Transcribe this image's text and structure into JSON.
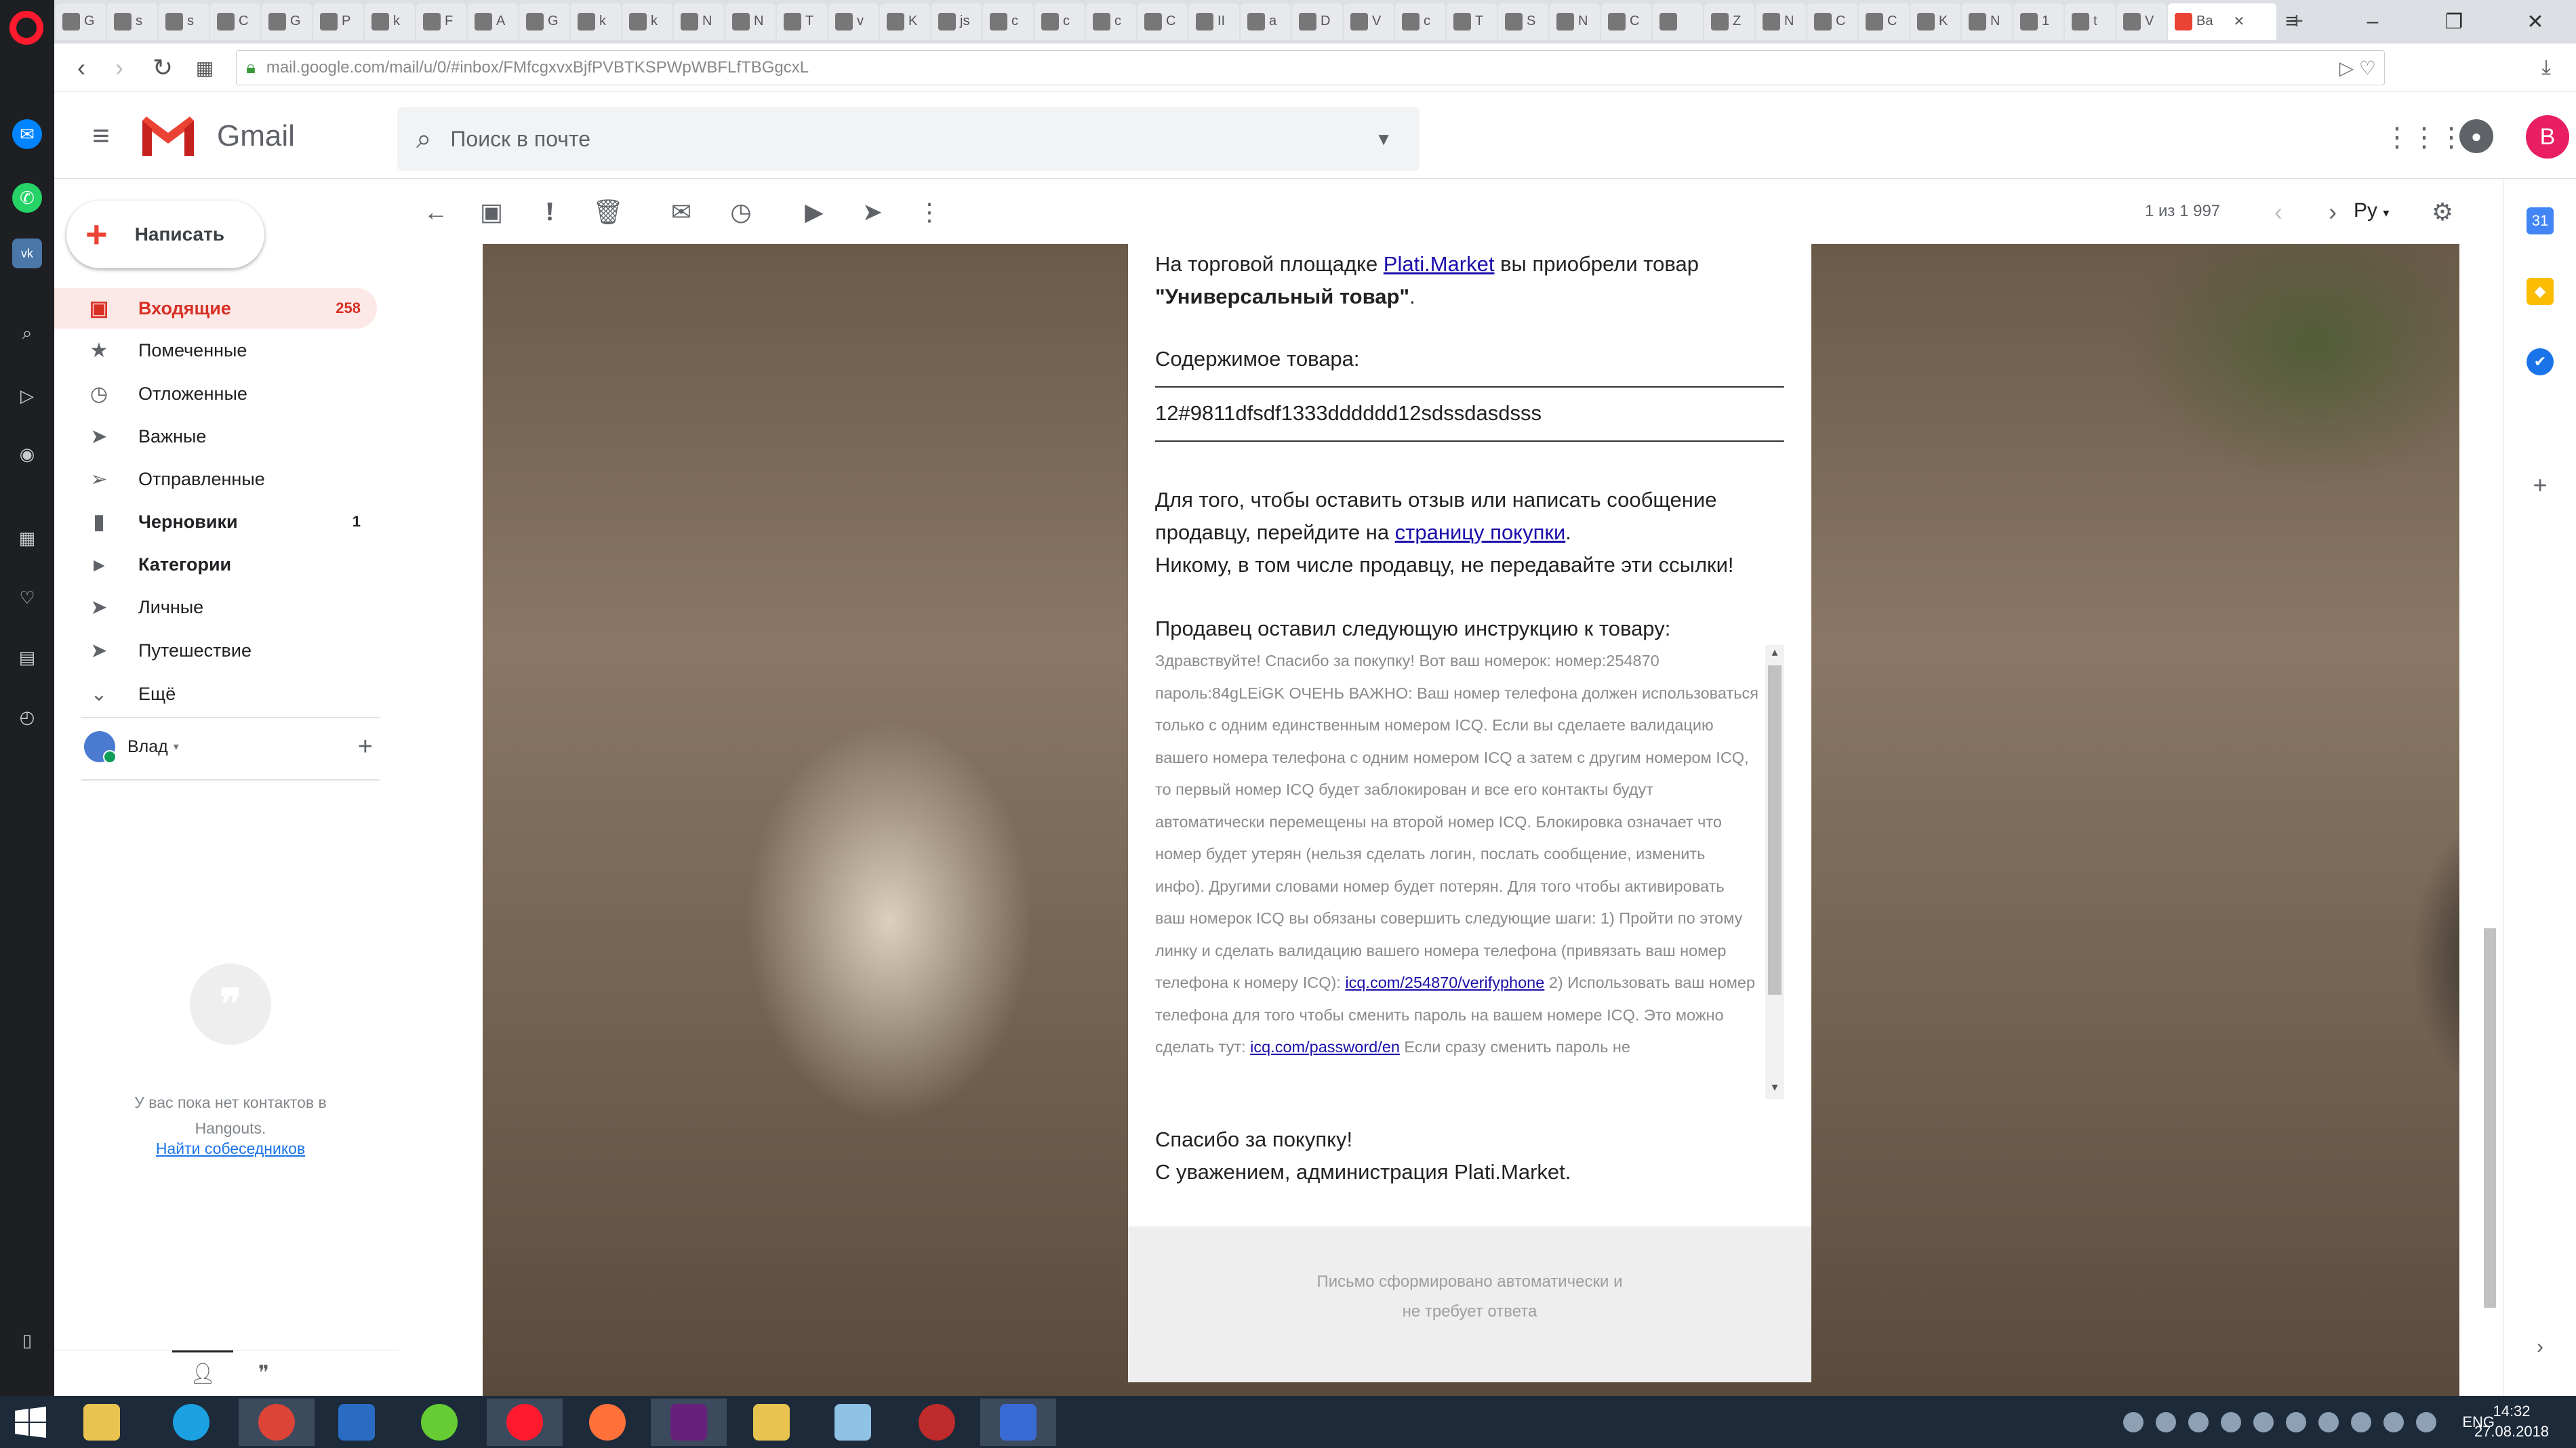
{
  "browser": {
    "tabs": [
      {
        "title": "G"
      },
      {
        "title": "s"
      },
      {
        "title": "s"
      },
      {
        "title": "C"
      },
      {
        "title": "G"
      },
      {
        "title": "P"
      },
      {
        "title": "k"
      },
      {
        "title": "F"
      },
      {
        "title": "A"
      },
      {
        "title": "G"
      },
      {
        "title": "k"
      },
      {
        "title": "k"
      },
      {
        "title": "N"
      },
      {
        "title": "N"
      },
      {
        "title": "T"
      },
      {
        "title": "v"
      },
      {
        "title": "K"
      },
      {
        "title": "js"
      },
      {
        "title": "c"
      },
      {
        "title": "c"
      },
      {
        "title": "c"
      },
      {
        "title": "C"
      },
      {
        "title": "II"
      },
      {
        "title": "a"
      },
      {
        "title": "D"
      },
      {
        "title": "V"
      },
      {
        "title": "c"
      },
      {
        "title": "T"
      },
      {
        "title": "S"
      },
      {
        "title": "N"
      },
      {
        "title": "C"
      },
      {
        "title": ""
      },
      {
        "title": "Z"
      },
      {
        "title": "N"
      },
      {
        "title": "C"
      },
      {
        "title": "C"
      },
      {
        "title": "K"
      },
      {
        "title": "N"
      },
      {
        "title": "1"
      },
      {
        "title": "t"
      },
      {
        "title": "V"
      }
    ],
    "active_tab": {
      "title": "Ва"
    },
    "url": "mail.google.com/mail/u/0/#inbox/FMfcgxvxBjfPVBTKSPWpWBFLfTBGgcxL"
  },
  "gmail": {
    "logo_text": "Gmail",
    "search_placeholder": "Поиск в почте",
    "avatar_letter": "В",
    "compose_label": "Написать",
    "nav": [
      {
        "label": "Входящие",
        "count": "258",
        "icon": "inbox-icon",
        "glyph": "▣",
        "active": true
      },
      {
        "label": "Помеченные",
        "count": "",
        "icon": "star-icon",
        "glyph": "★"
      },
      {
        "label": "Отложенные",
        "count": "",
        "icon": "clock-icon",
        "glyph": "◷"
      },
      {
        "label": "Важные",
        "count": "",
        "icon": "important-icon",
        "glyph": "➤"
      },
      {
        "label": "Отправленные",
        "count": "",
        "icon": "send-icon",
        "glyph": "➢"
      },
      {
        "label": "Черновики",
        "count": "1",
        "icon": "draft-icon",
        "glyph": "▮",
        "bold": true
      },
      {
        "label": "Категории",
        "count": "",
        "icon": "label-icon",
        "glyph": "▸",
        "bold": true
      },
      {
        "label": "Личные",
        "count": "",
        "icon": "label-icon",
        "glyph": "➤"
      },
      {
        "label": "Путешествие",
        "count": "",
        "icon": "label-icon",
        "glyph": "➤"
      },
      {
        "label": "Ещё",
        "count": "",
        "icon": "chevron-down-icon",
        "glyph": "⌄"
      }
    ],
    "user_name": "Влад",
    "hangouts_empty": "У вас пока нет контактов в Hangouts.",
    "hangouts_link": "Найти собеседников",
    "toolbar": {
      "count": "1 из 1 997",
      "lang": "Ру"
    }
  },
  "email": {
    "intro_prefix": "На торговой площадке ",
    "intro_link": "Plati.Market",
    "intro_suffix": " вы приобрели товар",
    "product_name": "\"Универсальный товар\"",
    "product_dot": ".",
    "contents_label": "Содержимое товара:",
    "contents_value": "12#9811dfsdf1333dddddd12sdssdasdsss",
    "review_prefix": "Для того, чтобы оставить отзыв или написать сообщение продавцу, перейдите на ",
    "review_link": "страницу покупки",
    "review_suffix": ".",
    "warning": "Никому, в том числе продавцу, не передавайте эти ссылки!",
    "instruction_label": "Продавец оставил следующую инструкцию к товару:",
    "instruction_part1": "Здравствуйте! Спасибо за покупку! Вот ваш номерок: номер:254870 пароль:84gLEiGK ОЧЕНЬ ВАЖНО: Ваш номер телефона должен использоваться только с одним единственным номером ICQ. Если вы сделаете валидацию вашего номера телефона с одним номером ICQ а затем с другим номером ICQ, то первый номер ICQ будет заблокирован и все его контакты будут автоматически перемещены на второй номер ICQ. Блокировка означает что номер будет утерян (нельзя сделать логин, послать сообщение, изменить инфо). Другими словами номер будет потерян. Для того чтобы активировать ваш номерок ICQ вы обязаны совершить следующие шаги: 1) Пройти по этому линку и сделать валидацию вашего номера телефона (привязать ваш номер телефона к номеру ICQ): ",
    "instruction_link1": "icq.com/254870/verifyphone",
    "instruction_part2": " 2) Использовать ваш номер телефона для того чтобы сменить пароль на вашем номере ICQ. Это можно сделать тут: ",
    "instruction_link2": "icq.com/password/en",
    "instruction_part3": " Если сразу сменить пароль не",
    "thanks": "Спасибо за покупку!",
    "regards": "С уважением, администрация Plati.Market.",
    "footer_line1": "Письмо сформировано автоматически и",
    "footer_line2": "не требует ответа"
  },
  "taskbar": {
    "lang": "ENG",
    "time": "14:32",
    "date": "27.08.2018"
  }
}
